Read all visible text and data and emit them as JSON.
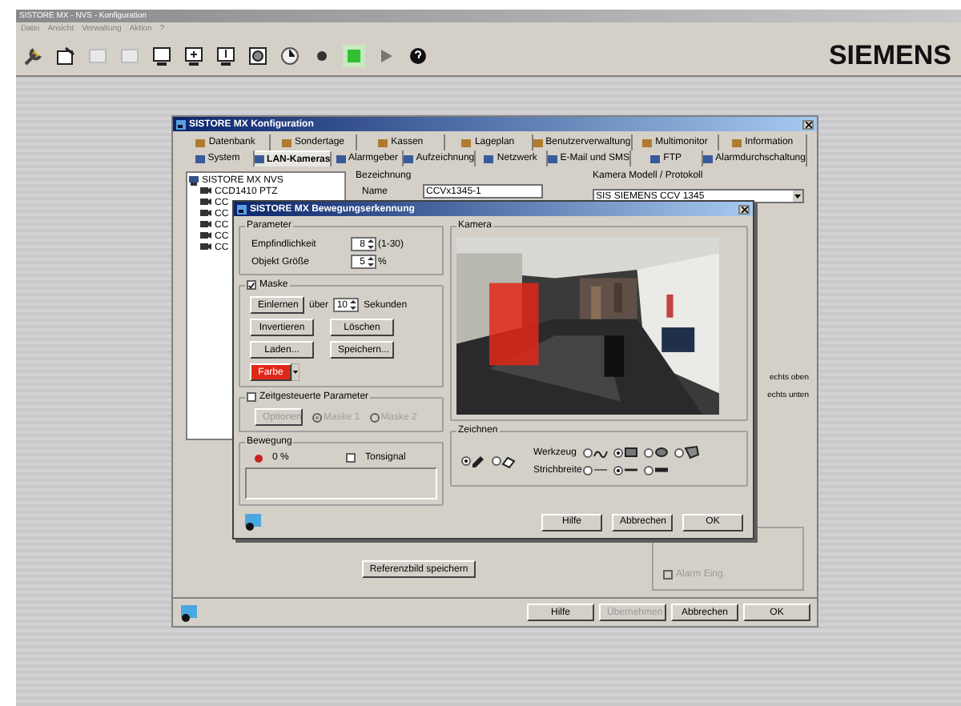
{
  "main_window": {
    "title": "SISTORE MX - NVS - Konfiguration",
    "menu": [
      "Datei",
      "Ansicht",
      "Verwaltung",
      "Aktion",
      "?"
    ],
    "logo": "SIEMENS"
  },
  "config_dialog": {
    "title": "SISTORE MX Konfiguration",
    "tabs": [
      [
        {
          "label": "Datenbank",
          "selected": false
        },
        {
          "label": "Sondertage",
          "selected": false
        },
        {
          "label": "Kassen",
          "selected": false
        },
        {
          "label": "Lageplan",
          "selected": false
        },
        {
          "label": "Benutzerverwaltung",
          "selected": false
        },
        {
          "label": "Multimonitor",
          "selected": false
        },
        {
          "label": "Information",
          "selected": false
        }
      ],
      [
        {
          "label": "System",
          "selected": false
        },
        {
          "label": "LAN-Kameras",
          "selected": true
        },
        {
          "label": "Alarmgeber",
          "selected": false
        },
        {
          "label": "Aufzeichnung",
          "selected": false
        },
        {
          "label": "Netzwerk",
          "selected": false
        },
        {
          "label": "E-Mail und SMS",
          "selected": false
        },
        {
          "label": "FTP",
          "selected": false
        },
        {
          "label": "Alarmdurchschaltung",
          "selected": false
        }
      ]
    ],
    "tree": {
      "label": "SISTORE MX NVS",
      "expanded": true,
      "children": [
        {
          "label": "CCD1410 PTZ"
        },
        {
          "label": "CC"
        },
        {
          "label": "CC"
        },
        {
          "label": "CC"
        },
        {
          "label": "CC"
        },
        {
          "label": "CC"
        }
      ]
    },
    "designation_label": "Bezeichnung",
    "name_label": "Name",
    "name_value": "CCVx1345-1",
    "model_label": "Kamera Modell / Protokoll",
    "model_value": "SIS SIEMENS CCV 1345",
    "side_labels": [
      "echts oben",
      "echts unten"
    ],
    "alarm_checkbox": {
      "label": "Alarm Eing.",
      "checked": false
    },
    "reference_button": "Referenzbild speichern",
    "buttons": [
      {
        "label": "Hilfe",
        "disabled": false
      },
      {
        "label": "Übernehmen",
        "disabled": true
      },
      {
        "label": "Abbrechen",
        "disabled": false
      },
      {
        "label": "OK",
        "disabled": false
      }
    ]
  },
  "motion_dialog": {
    "title": "SISTORE MX Bewegungserkennung",
    "parameter_group": "Parameter",
    "sensitivity": {
      "label": "Empfindlichkeit",
      "value": "8",
      "range": "(1-30)"
    },
    "object_size": {
      "label": "Objekt Größe",
      "value": "5",
      "unit": "%"
    },
    "mask": {
      "label": "Maske",
      "checked": true,
      "learn_button": "Einlernen",
      "over_label": "über",
      "seconds_value": "10",
      "seconds_label": "Sekunden",
      "buttons": [
        "Invertieren",
        "Löschen",
        "Laden...",
        "Speichern..."
      ],
      "color_button": "Farbe",
      "color": "#e02818"
    },
    "timed": {
      "label": "Zeitgesteuerte Parameter",
      "checked": false,
      "options_button": "Optionen",
      "radios": [
        {
          "label": "Maske 1",
          "selected": true
        },
        {
          "label": "Maske 2",
          "selected": false
        }
      ]
    },
    "motion": {
      "label": "Bewegung",
      "alarm": true,
      "percent": "0 %",
      "tone": {
        "label": "Tonsignal",
        "checked": false
      }
    },
    "camera_label": "Kamera",
    "draw": {
      "label": "Zeichnen",
      "modes": [
        {
          "kind": "pen",
          "selected": true
        },
        {
          "kind": "eraser",
          "selected": false
        }
      ],
      "tool_label": "Werkzeug",
      "tools": [
        {
          "kind": "freehand",
          "selected": false
        },
        {
          "kind": "rectangle",
          "selected": true
        },
        {
          "kind": "ellipse",
          "selected": false
        },
        {
          "kind": "polygon",
          "selected": false
        }
      ],
      "width_label": "Strichbreite",
      "widths": [
        {
          "kind": "thin",
          "selected": false
        },
        {
          "kind": "medium",
          "selected": true
        },
        {
          "kind": "thick",
          "selected": false
        }
      ]
    },
    "buttons": [
      "Hilfe",
      "Abbrechen",
      "OK"
    ]
  }
}
